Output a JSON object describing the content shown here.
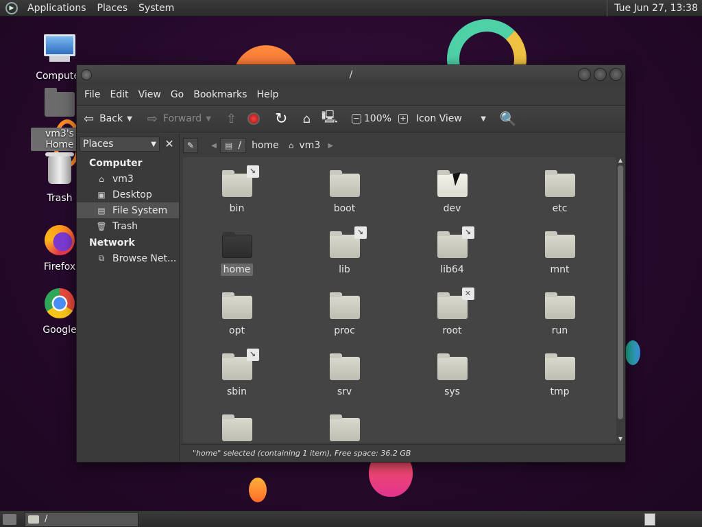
{
  "top_panel": {
    "menus": [
      "Applications",
      "Places",
      "System"
    ],
    "clock": "Tue Jun 27, 13:38"
  },
  "desktop_icons": [
    {
      "label": "Computer",
      "icon": "computer-icon"
    },
    {
      "label": "vm3's Home",
      "icon": "home-folder-icon"
    },
    {
      "label": "Trash",
      "icon": "trash-icon"
    },
    {
      "label": "Firefox",
      "icon": "firefox-icon"
    },
    {
      "label": "Google",
      "icon": "chrome-icon"
    }
  ],
  "window": {
    "title": "/",
    "menubar": [
      "File",
      "Edit",
      "View",
      "Go",
      "Bookmarks",
      "Help"
    ],
    "toolbar": {
      "back": "Back",
      "forward": "Forward",
      "zoom": "100%",
      "view_mode": "Icon View"
    },
    "sidebar": {
      "selector": "Places",
      "sections": [
        {
          "title": "Computer",
          "items": [
            {
              "label": "vm3",
              "icon": "home-icon"
            },
            {
              "label": "Desktop",
              "icon": "desktop-icon"
            },
            {
              "label": "File System",
              "icon": "drive-icon",
              "active": true
            },
            {
              "label": "Trash",
              "icon": "trash-icon"
            }
          ]
        },
        {
          "title": "Network",
          "items": [
            {
              "label": "Browse Net...",
              "icon": "network-icon"
            }
          ]
        }
      ]
    },
    "breadcrumb": [
      {
        "label": "/",
        "icon": "drive-icon",
        "current": true
      },
      {
        "label": "home",
        "icon": ""
      },
      {
        "label": "vm3",
        "icon": "home-icon"
      }
    ],
    "files": [
      {
        "name": "bin",
        "emblem": "link"
      },
      {
        "name": "boot",
        "emblem": ""
      },
      {
        "name": "dev",
        "emblem": "",
        "style": "bright"
      },
      {
        "name": "etc",
        "emblem": ""
      },
      {
        "name": "home",
        "emblem": "",
        "selected": true,
        "style": "dark"
      },
      {
        "name": "lib",
        "emblem": "link"
      },
      {
        "name": "lib64",
        "emblem": "link"
      },
      {
        "name": "mnt",
        "emblem": ""
      },
      {
        "name": "opt",
        "emblem": ""
      },
      {
        "name": "proc",
        "emblem": ""
      },
      {
        "name": "root",
        "emblem": "noaccess"
      },
      {
        "name": "run",
        "emblem": ""
      },
      {
        "name": "sbin",
        "emblem": "link"
      },
      {
        "name": "srv",
        "emblem": ""
      },
      {
        "name": "sys",
        "emblem": ""
      },
      {
        "name": "tmp",
        "emblem": ""
      },
      {
        "name": "",
        "emblem": ""
      },
      {
        "name": "",
        "emblem": ""
      }
    ],
    "status": "\"home\" selected (containing 1 item), Free space: 36.2 GB"
  },
  "taskbar": {
    "task_label": "/"
  }
}
